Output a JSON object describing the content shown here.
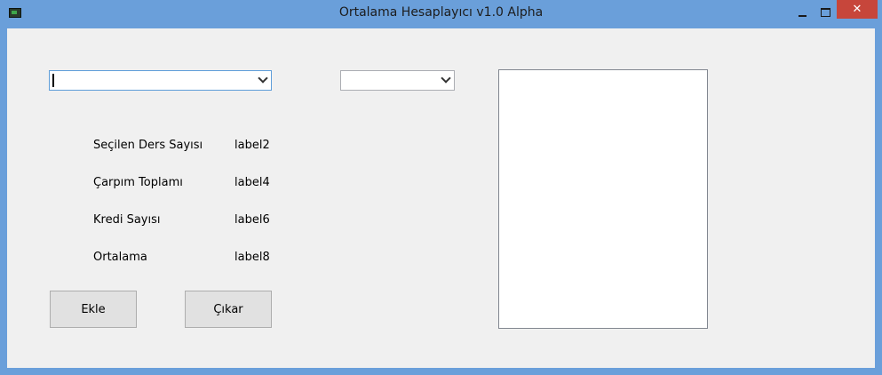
{
  "window": {
    "title": "Ortalama Hesaplayıcı v1.0 Alpha",
    "controls": {
      "minimize_icon": "minimize-icon",
      "maximize_icon": "maximize-icon",
      "close_label": "✕"
    }
  },
  "form": {
    "combo_course": {
      "value": ""
    },
    "combo_grade": {
      "value": ""
    },
    "labels": [
      {
        "caption": "Seçilen Ders Sayısı",
        "value": "label2"
      },
      {
        "caption": "Çarpım Toplamı",
        "value": "label4"
      },
      {
        "caption": "Kredi Sayısı",
        "value": "label6"
      },
      {
        "caption": "Ortalama",
        "value": "label8"
      }
    ],
    "buttons": {
      "add_label": "Ekle",
      "remove_label": "Çıkar"
    },
    "list": {
      "items": []
    }
  },
  "colors": {
    "titlebar": "#6a9fda",
    "close_button": "#c7463b",
    "client_background": "#f0f0f0"
  }
}
